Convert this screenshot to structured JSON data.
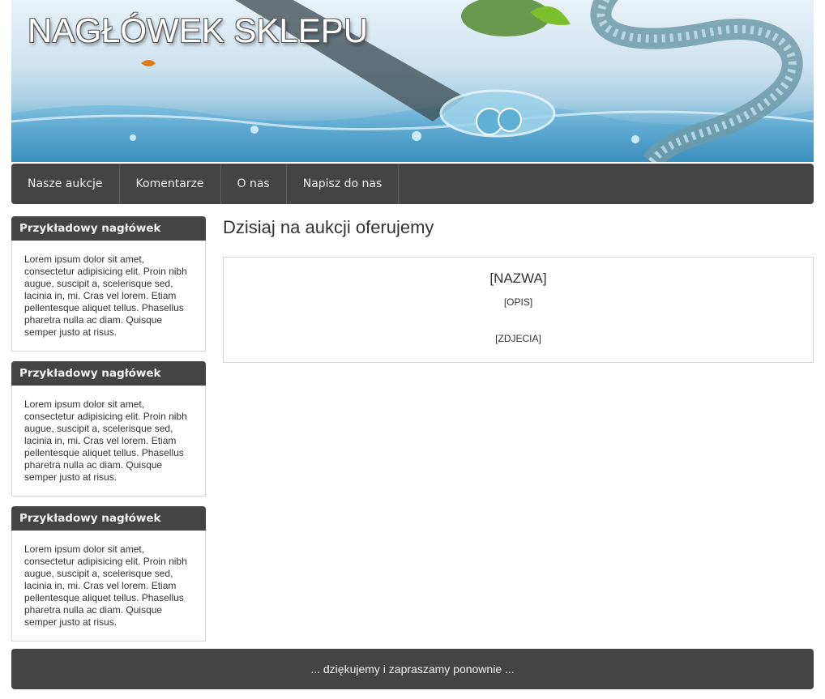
{
  "header": {
    "title": "NAGŁÓWEK SKLEPU"
  },
  "nav": {
    "items": [
      {
        "label": "Nasze aukcje"
      },
      {
        "label": "Komentarze"
      },
      {
        "label": "O nas"
      },
      {
        "label": "Napisz do nas"
      }
    ]
  },
  "sidebar": {
    "boxes": [
      {
        "title": "Przykładowy nagłówek",
        "text": "Lorem ipsum dolor sit amet, consectetur adipisicing elit. Proin nibh augue, suscipit a, scelerisque sed, lacinia in, mi. Cras vel lorem. Etiam pellentesque aliquet tellus. Phasellus pharetra nulla ac diam. Quisque semper justo at risus."
      },
      {
        "title": "Przykładowy nagłówek",
        "text": "Lorem ipsum dolor sit amet, consectetur adipisicing elit. Proin nibh augue, suscipit a, scelerisque sed, lacinia in, mi. Cras vel lorem. Etiam pellentesque aliquet tellus. Phasellus pharetra nulla ac diam. Quisque semper justo at risus."
      },
      {
        "title": "Przykładowy nagłówek",
        "text": "Lorem ipsum dolor sit amet, consectetur adipisicing elit. Proin nibh augue, suscipit a, scelerisque sed, lacinia in, mi. Cras vel lorem. Etiam pellentesque aliquet tellus. Phasellus pharetra nulla ac diam. Quisque semper justo at risus."
      }
    ]
  },
  "main": {
    "title": "Dzisiaj na aukcji oferujemy",
    "item": {
      "name": "[NAZWA]",
      "description": "[OPIS]",
      "photos": "[ZDJECIA]"
    }
  },
  "footer": {
    "text": "... dziękujemy i zapraszamy ponownie ..."
  },
  "colors": {
    "bar": "#444444",
    "border": "#d6d6d6",
    "text": "#333333"
  }
}
